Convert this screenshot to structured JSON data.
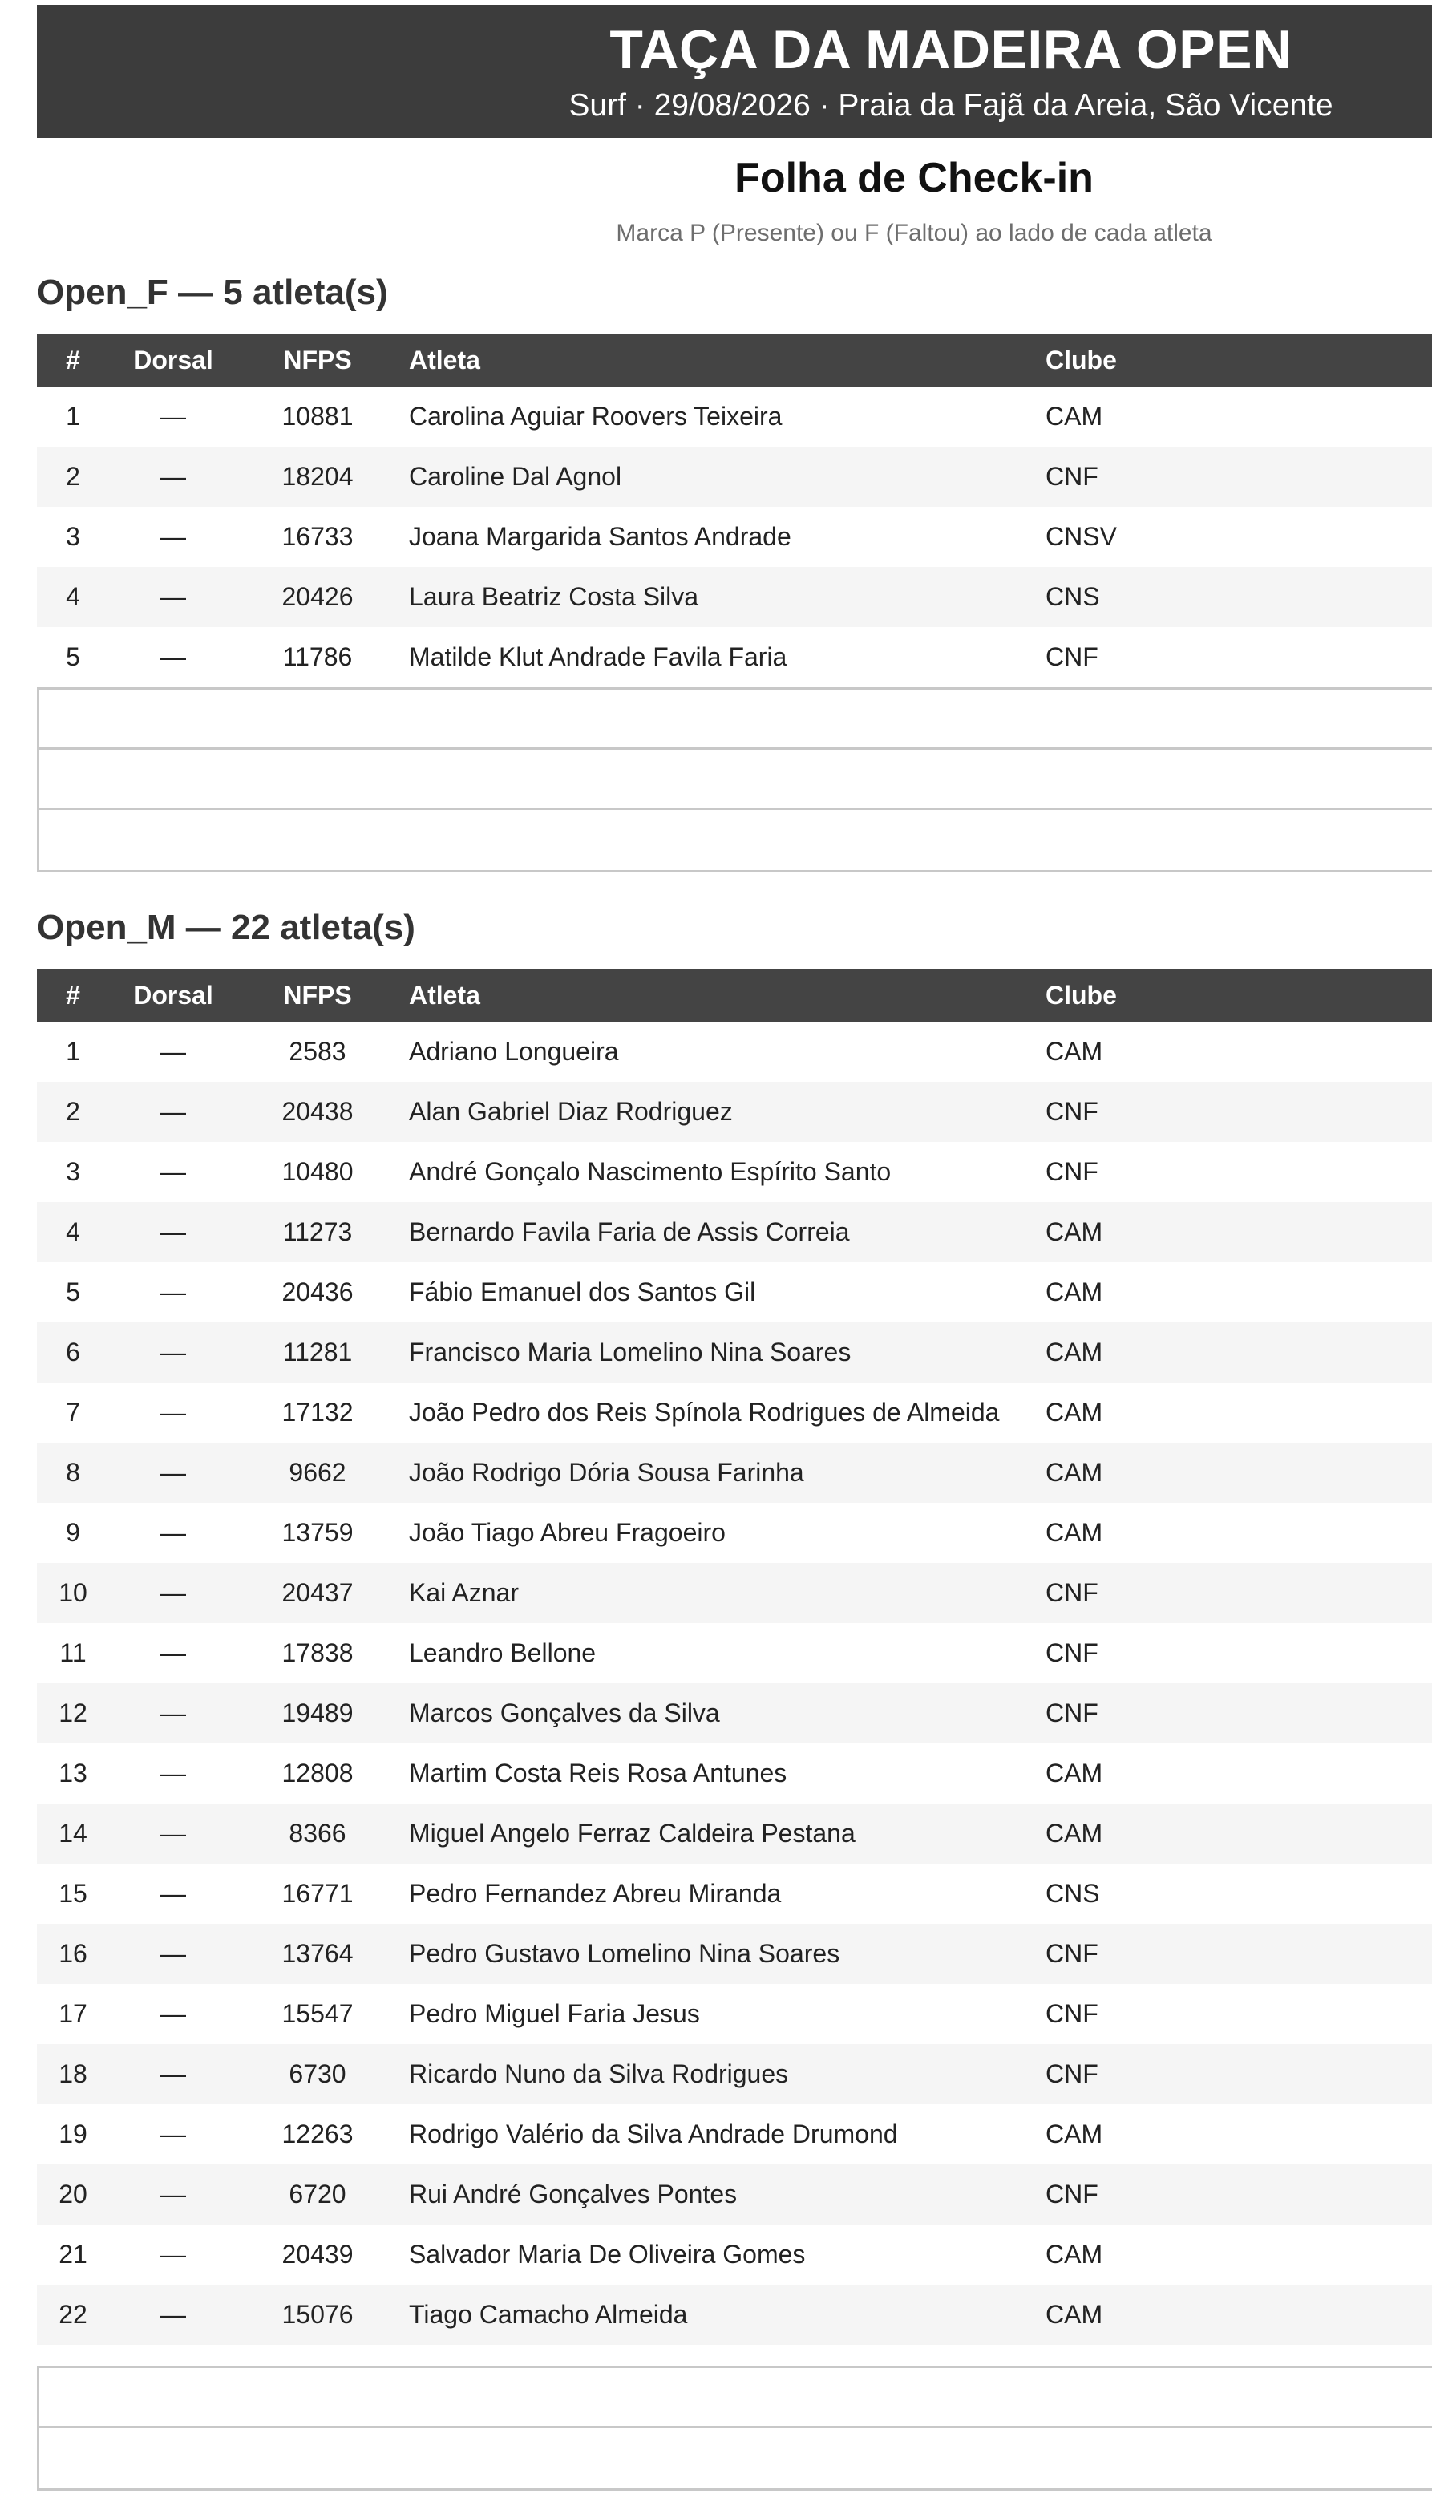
{
  "header": {
    "title": "TAÇA DA MADEIRA OPEN",
    "subtitle": "Surf · 29/08/2026 · Praia da Fajã da Areia, São Vicente"
  },
  "sheet": {
    "title": "Folha de Check-in",
    "note": "Marca P (Presente) ou F (Faltou) ao lado de cada atleta"
  },
  "columns": {
    "num": "#",
    "dorsal": "Dorsal",
    "nfps": "NFPS",
    "athlete": "Atleta",
    "club": "Clube"
  },
  "sections": [
    {
      "title": "Open_F — 5 atleta(s)",
      "blank_rows": 3,
      "rows": [
        {
          "num": "1",
          "dorsal": "—",
          "nfps": "10881",
          "athlete": "Carolina Aguiar Roovers Teixeira",
          "club": "CAM"
        },
        {
          "num": "2",
          "dorsal": "—",
          "nfps": "18204",
          "athlete": "Caroline Dal Agnol",
          "club": "CNF"
        },
        {
          "num": "3",
          "dorsal": "—",
          "nfps": "16733",
          "athlete": "Joana Margarida Santos Andrade",
          "club": "CNSV"
        },
        {
          "num": "4",
          "dorsal": "—",
          "nfps": "20426",
          "athlete": "Laura Beatriz Costa Silva",
          "club": "CNS"
        },
        {
          "num": "5",
          "dorsal": "—",
          "nfps": "11786",
          "athlete": "Matilde Klut Andrade Favila Faria",
          "club": "CNF"
        }
      ]
    },
    {
      "title": "Open_M — 22 atleta(s)",
      "blank_rows": 2,
      "rows": [
        {
          "num": "1",
          "dorsal": "—",
          "nfps": "2583",
          "athlete": "Adriano Longueira",
          "club": "CAM"
        },
        {
          "num": "2",
          "dorsal": "—",
          "nfps": "20438",
          "athlete": "Alan Gabriel Diaz Rodriguez",
          "club": "CNF"
        },
        {
          "num": "3",
          "dorsal": "—",
          "nfps": "10480",
          "athlete": "André Gonçalo Nascimento Espírito Santo",
          "club": "CNF"
        },
        {
          "num": "4",
          "dorsal": "—",
          "nfps": "11273",
          "athlete": "Bernardo Favila Faria de Assis Correia",
          "club": "CAM"
        },
        {
          "num": "5",
          "dorsal": "—",
          "nfps": "20436",
          "athlete": "Fábio Emanuel dos Santos Gil",
          "club": "CAM"
        },
        {
          "num": "6",
          "dorsal": "—",
          "nfps": "11281",
          "athlete": "Francisco Maria Lomelino Nina Soares",
          "club": "CAM"
        },
        {
          "num": "7",
          "dorsal": "—",
          "nfps": "17132",
          "athlete": "João Pedro dos Reis Spínola Rodrigues de Almeida",
          "club": "CAM"
        },
        {
          "num": "8",
          "dorsal": "—",
          "nfps": "9662",
          "athlete": "João Rodrigo Dória Sousa Farinha",
          "club": "CAM"
        },
        {
          "num": "9",
          "dorsal": "—",
          "nfps": "13759",
          "athlete": "João Tiago Abreu Fragoeiro",
          "club": "CAM"
        },
        {
          "num": "10",
          "dorsal": "—",
          "nfps": "20437",
          "athlete": "Kai Aznar",
          "club": "CNF"
        },
        {
          "num": "11",
          "dorsal": "—",
          "nfps": "17838",
          "athlete": "Leandro Bellone",
          "club": "CNF"
        },
        {
          "num": "12",
          "dorsal": "—",
          "nfps": "19489",
          "athlete": "Marcos Gonçalves da Silva",
          "club": "CNF"
        },
        {
          "num": "13",
          "dorsal": "—",
          "nfps": "12808",
          "athlete": "Martim Costa Reis Rosa Antunes",
          "club": "CAM"
        },
        {
          "num": "14",
          "dorsal": "—",
          "nfps": "8366",
          "athlete": "Miguel Angelo Ferraz Caldeira Pestana",
          "club": "CAM"
        },
        {
          "num": "15",
          "dorsal": "—",
          "nfps": "16771",
          "athlete": "Pedro Fernandez Abreu Miranda",
          "club": "CNS"
        },
        {
          "num": "16",
          "dorsal": "—",
          "nfps": "13764",
          "athlete": "Pedro Gustavo Lomelino Nina Soares",
          "club": "CNF"
        },
        {
          "num": "17",
          "dorsal": "—",
          "nfps": "15547",
          "athlete": "Pedro Miguel Faria Jesus",
          "club": "CNF"
        },
        {
          "num": "18",
          "dorsal": "—",
          "nfps": "6730",
          "athlete": "Ricardo Nuno da Silva Rodrigues",
          "club": "CNF"
        },
        {
          "num": "19",
          "dorsal": "—",
          "nfps": "12263",
          "athlete": "Rodrigo Valério da Silva Andrade Drumond",
          "club": "CAM"
        },
        {
          "num": "20",
          "dorsal": "—",
          "nfps": "6720",
          "athlete": "Rui André Gonçalves Pontes",
          "club": "CNF"
        },
        {
          "num": "21",
          "dorsal": "—",
          "nfps": "20439",
          "athlete": "Salvador Maria De Oliveira Gomes",
          "club": "CAM"
        },
        {
          "num": "22",
          "dorsal": "—",
          "nfps": "15076",
          "athlete": "Tiago Camacho Almeida",
          "club": "CAM"
        }
      ]
    }
  ]
}
